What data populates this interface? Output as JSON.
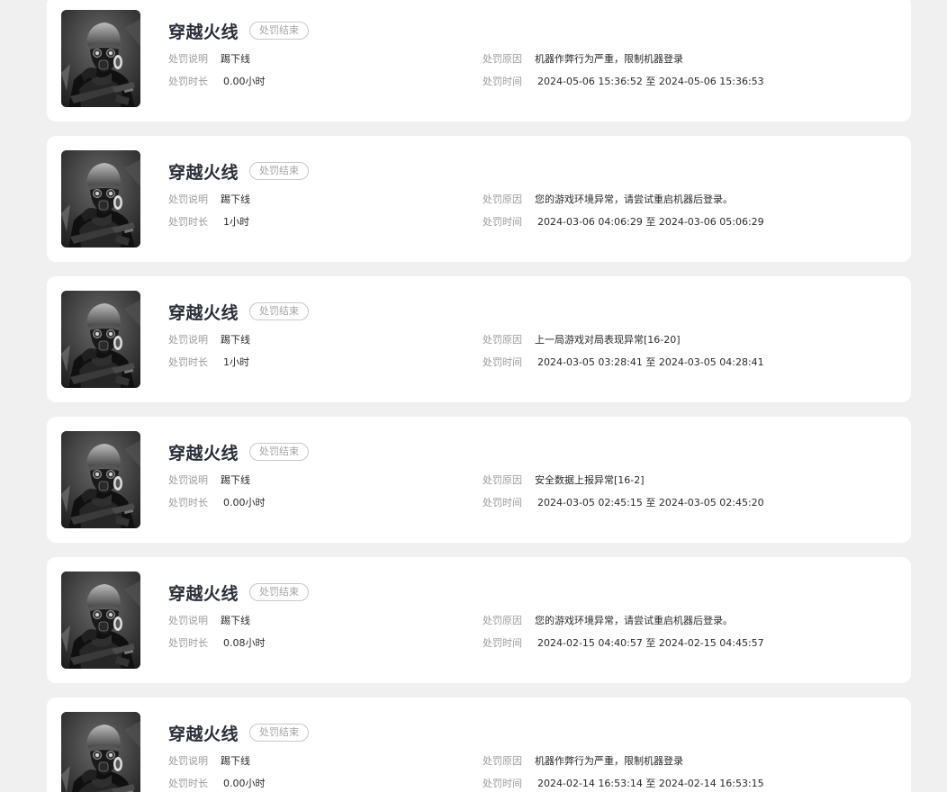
{
  "labels": {
    "description": "处罚说明",
    "duration": "处罚时长",
    "reason": "处罚原因",
    "time": "处罚时间"
  },
  "records": [
    {
      "game": "穿越火线",
      "status": "处罚结束",
      "description": "踢下线",
      "duration": "0.00小时",
      "reason": "机器作弊行为严重，限制机器登录",
      "time": "2024-05-06 15:36:52 至 2024-05-06 15:36:53"
    },
    {
      "game": "穿越火线",
      "status": "处罚结束",
      "description": "踢下线",
      "duration": "1小时",
      "reason": "您的游戏环境异常，请尝试重启机器后登录。",
      "time": "2024-03-06 04:06:29 至 2024-03-06 05:06:29"
    },
    {
      "game": "穿越火线",
      "status": "处罚结束",
      "description": "踢下线",
      "duration": "1小时",
      "reason": "上一局游戏对局表现异常[16-20]",
      "time": "2024-03-05 03:28:41 至 2024-03-05 04:28:41"
    },
    {
      "game": "穿越火线",
      "status": "处罚结束",
      "description": "踢下线",
      "duration": "0.00小时",
      "reason": "安全数据上报异常[16-2]",
      "time": "2024-03-05 02:45:15 至 2024-03-05 02:45:20"
    },
    {
      "game": "穿越火线",
      "status": "处罚结束",
      "description": "踢下线",
      "duration": "0.08小时",
      "reason": "您的游戏环境异常，请尝试重启机器后登录。",
      "time": "2024-02-15 04:40:57 至 2024-02-15 04:45:57"
    },
    {
      "game": "穿越火线",
      "status": "处罚结束",
      "description": "踢下线",
      "duration": "0.00小时",
      "reason": "机器作弊行为严重，限制机器登录",
      "time": "2024-02-14 16:53:14 至 2024-02-14 16:53:15"
    }
  ]
}
